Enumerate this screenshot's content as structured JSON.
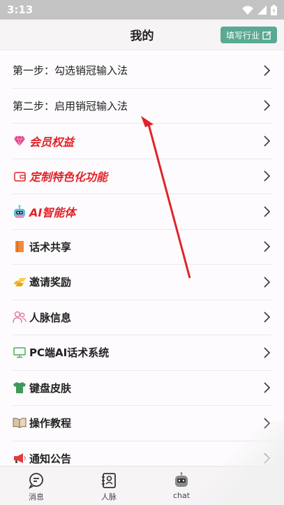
{
  "status": {
    "time": "3:13"
  },
  "header": {
    "title": "我的",
    "industry_button": "填写行业"
  },
  "menu": [
    {
      "label": "第一步：勾选销冠输入法",
      "icon": "none"
    },
    {
      "label": "第二步：启用销冠输入法",
      "icon": "none"
    },
    {
      "label": "会员权益",
      "icon": "diamond-icon"
    },
    {
      "label": "定制特色化功能",
      "icon": "wallet-icon"
    },
    {
      "label": "AI智能体",
      "icon": "robot-icon"
    },
    {
      "label": "话术共享",
      "icon": "book-icon"
    },
    {
      "label": "邀请奖励",
      "icon": "gold-bar-icon"
    },
    {
      "label": "人脉信息",
      "icon": "people-icon"
    },
    {
      "label": "PC端AI话术系统",
      "icon": "monitor-icon"
    },
    {
      "label": "键盘皮肤",
      "icon": "tshirt-icon"
    },
    {
      "label": "操作教程",
      "icon": "open-book-icon"
    },
    {
      "label": "通知公告",
      "icon": "megaphone-icon"
    }
  ],
  "tabbar": [
    {
      "label": "消息",
      "icon": "chat-bubble-icon"
    },
    {
      "label": "人脉",
      "icon": "contacts-icon"
    },
    {
      "label": "chat",
      "icon": "robot-icon"
    }
  ],
  "colors": {
    "accent": "#5aa994",
    "highlight_red": "#e0232a"
  }
}
